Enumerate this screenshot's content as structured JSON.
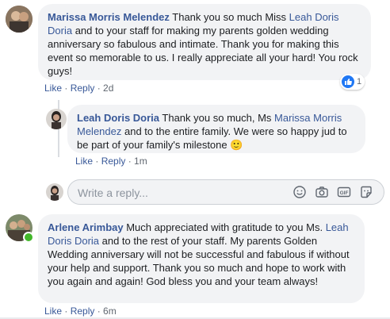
{
  "comments": [
    {
      "name": "Marissa Morris Melendez",
      "text_1": " Thank you so much Miss ",
      "mention": "Leah Doris Doria",
      "text_2": " and to your staff for making my parents golden wedding anniversary so fabulous and intimate. Thank you for making this event so memorable to us. I really appreciate all your hard! You rock guys!",
      "like": "Like",
      "reply": "Reply",
      "time": "2d",
      "reaction_count": "1"
    },
    {
      "name": "Leah Doris Doria",
      "text_1": " Thank you so much, Ms ",
      "mention": "Marissa Morris Melendez",
      "text_2": " and to the entire family. We were so happy jud to be part of your family's milestone ",
      "emoji": "🙂",
      "like": "Like",
      "reply": "Reply",
      "time": "1m"
    },
    {
      "name": "Arlene Arimbay",
      "text_1": " Much appreciated with gratitude to you Ms. ",
      "mention": "Leah Doris Doria",
      "text_2": " and to the rest of your staff. My parents Golden Wedding anniversary will not be successful and fabulous if without your help and support. Thank you so much and hope to work with you again and again! God bless you and your team always!",
      "like": "Like",
      "reply": "Reply",
      "time": "6m"
    }
  ],
  "reply_box": {
    "placeholder": "Write a reply...",
    "icons": [
      "smiley-icon",
      "camera-icon",
      "gif-icon",
      "sticker-icon"
    ]
  },
  "colors": {
    "link": "#385898",
    "bubble": "#f2f3f5",
    "meta": "#606770",
    "online": "#42b72a",
    "like_blue": "#2078f4"
  }
}
